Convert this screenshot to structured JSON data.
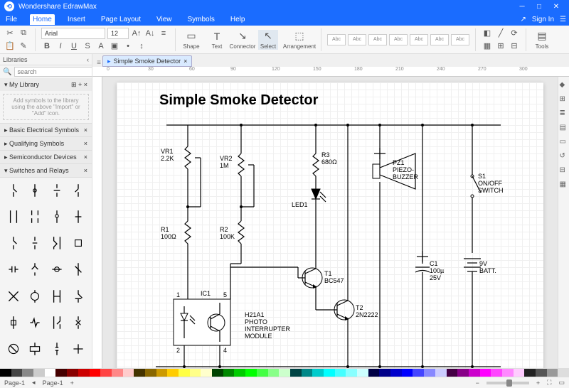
{
  "app": {
    "title": "Wondershare EdrawMax",
    "signin": "Sign In"
  },
  "menu": {
    "items": [
      "File",
      "Home",
      "Insert",
      "Page Layout",
      "View",
      "Symbols",
      "Help"
    ],
    "active": 1
  },
  "ribbon": {
    "font": "Arial",
    "size": "12",
    "shape": "Shape",
    "text": "Text",
    "connector": "Connector",
    "select": "Select",
    "arrangement": "Arrangement",
    "stylelabel": "Abc",
    "tools": "Tools"
  },
  "sidebar": {
    "libraries": "Libraries",
    "search_ph": "search",
    "mylib": "My Library",
    "hint": "Add symbols to the library using the above \"Import\" or \"Add\" icon.",
    "groups": [
      "Basic Electrical Symbols",
      "Qualifying Symbols",
      "Semiconductor Devices",
      "Switches and Relays"
    ]
  },
  "doc": {
    "tab": "Simple Smoke Detector",
    "title": "Simple Smoke Detector"
  },
  "status": {
    "page": "Page-1",
    "page2": "Page-1"
  },
  "ruler_ticks": [
    0,
    30,
    60,
    90,
    120,
    150,
    180,
    210,
    240,
    270,
    300
  ],
  "components": {
    "vr1": "VR1\n2.2K",
    "vr2": "VR2\n1M",
    "r3": "R3\n680Ω",
    "r1": "R1\n100Ω",
    "r2": "R2\n100K",
    "led1": "LED1",
    "t1": "T1\nBC547",
    "t2": "T2\n2N2222",
    "ic1": "IC1",
    "ic1_pins": {
      "p1": "1",
      "p2": "2",
      "p4": "4",
      "p5": "5"
    },
    "h21": "H21A1\nPHOTO\nINTERRUPTER\nMODULE",
    "pz1": "PZ1\nPIEZO-\nBUZZER",
    "c1": "C1\n100µ\n25V",
    "s1": "S1\nON/OFF\nSWITCH",
    "batt": "9V\nBATT."
  },
  "colors": [
    "#000",
    "#444",
    "#888",
    "#ccc",
    "#fff",
    "#400",
    "#800",
    "#c00",
    "#f00",
    "#f44",
    "#f88",
    "#fcc",
    "#430",
    "#860",
    "#c90",
    "#fc0",
    "#ff4",
    "#ff8",
    "#ffc",
    "#040",
    "#080",
    "#0c0",
    "#0f0",
    "#4f4",
    "#8f8",
    "#cfc",
    "#044",
    "#088",
    "#0cc",
    "#0ff",
    "#4ff",
    "#8ff",
    "#cff",
    "#004",
    "#008",
    "#00c",
    "#00f",
    "#44f",
    "#88f",
    "#ccf",
    "#404",
    "#808",
    "#c0c",
    "#f0f",
    "#f4f",
    "#f8f",
    "#fcf",
    "#222",
    "#555",
    "#999",
    "#ddd"
  ]
}
